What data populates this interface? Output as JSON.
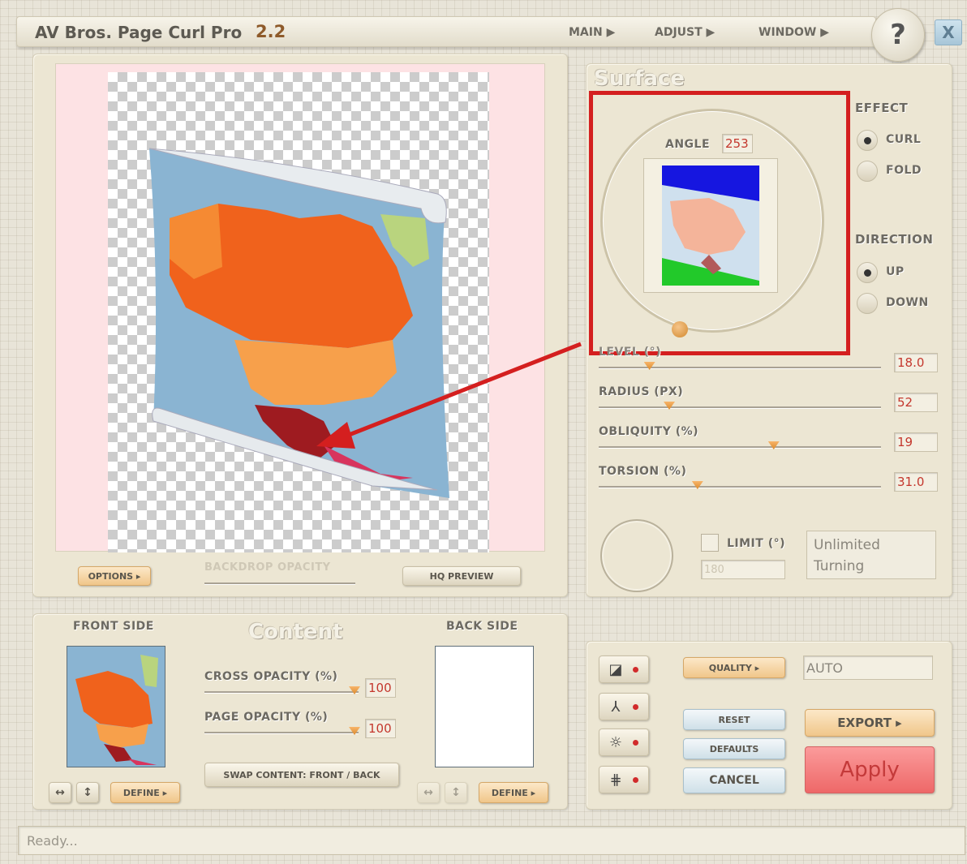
{
  "app": {
    "title": "AV Bros. Page Curl Pro",
    "version": "2.2",
    "menu": [
      "MAIN ▶",
      "ADJUST ▶",
      "WINDOW ▶"
    ],
    "help_label": "?",
    "close_label": "X"
  },
  "preview": {
    "options_label": "OPTIONS ▸",
    "backdrop_label": "BACKDROP OPACITY",
    "hq_label": "HQ PREVIEW"
  },
  "surface": {
    "title": "Surface",
    "angle_label": "ANGLE",
    "angle_value": "253",
    "effect_label": "EFFECT",
    "effect_options": [
      "CURL",
      "FOLD"
    ],
    "effect_selected": "CURL",
    "direction_label": "DIRECTION",
    "direction_options": [
      "UP",
      "DOWN"
    ],
    "direction_selected": "UP",
    "params": [
      {
        "label": "LEVEL (°)",
        "value": "18.0",
        "fraction": 0.18
      },
      {
        "label": "RADIUS (PX)",
        "value": "52",
        "fraction": 0.25
      },
      {
        "label": "OBLIQUITY (%)",
        "value": "19",
        "fraction": 0.62
      },
      {
        "label": "TORSION (%)",
        "value": "31.0",
        "fraction": 0.35
      }
    ],
    "limit_label": "LIMIT (°)",
    "limit_value": "180",
    "turning_text": "Unlimited Turning"
  },
  "content": {
    "title": "Content",
    "front_label": "FRONT SIDE",
    "back_label": "BACK SIDE",
    "cross_opacity_label": "CROSS OPACITY (%)",
    "cross_opacity_value": "100",
    "page_opacity_label": "PAGE OPACITY (%)",
    "page_opacity_value": "100",
    "swap_label": "SWAP CONTENT: FRONT / BACK",
    "define_label": "DEFINE ▸"
  },
  "actions": {
    "quality_label": "QUALITY ▸",
    "quality_value": "AUTO",
    "reset_label": "RESET",
    "defaults_label": "DEFAULTS",
    "cancel_label": "CANCEL",
    "export_label": "EXPORT ▸",
    "apply_label": "Apply"
  },
  "status": {
    "text": "Ready..."
  },
  "colors": {
    "accent_red": "#d41f1f",
    "apply": "#f06a6a",
    "map_ocean": "#8ab4d2"
  }
}
